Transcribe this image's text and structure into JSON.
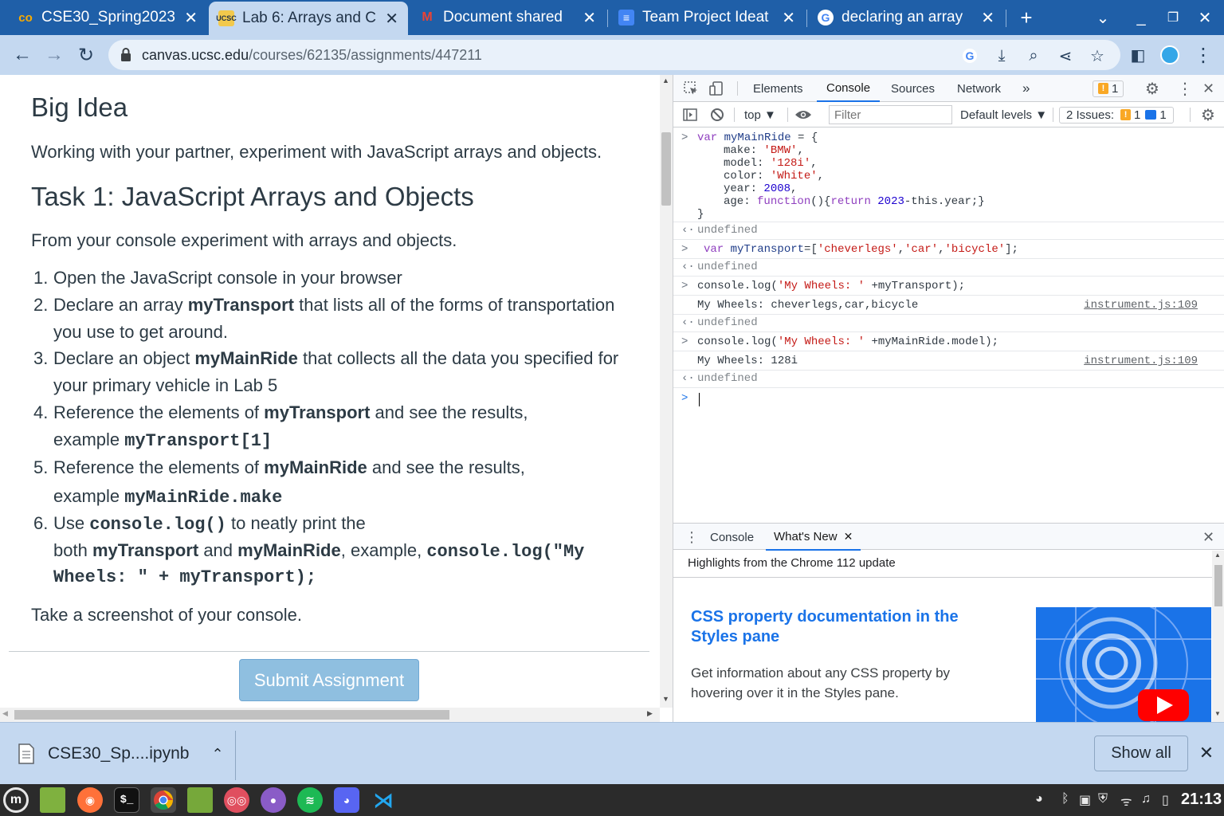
{
  "browser": {
    "tabs": [
      {
        "title": "CSE30_Spring2023",
        "icon": "colab-icon"
      },
      {
        "title": "Lab 6: Arrays and C",
        "icon": "ucsc-icon"
      },
      {
        "title": "Document shared",
        "icon": "gmail-icon"
      },
      {
        "title": "Team Project Ideat",
        "icon": "docs-icon"
      },
      {
        "title": "declaring an array",
        "icon": "google-icon"
      }
    ],
    "url_host": "canvas.ucsc.edu",
    "url_path": "/courses/62135/assignments/447211"
  },
  "page": {
    "heading1": "Big Idea",
    "intro": "Working with your partner, experiment with JavaScript arrays and objects.",
    "heading2": "Task 1: JavaScript Arrays and Objects",
    "lead": "From your console experiment with arrays and objects.",
    "items": {
      "i1": {
        "num": "1.",
        "text": "Open the JavaScript console in your browser"
      },
      "i2": {
        "num": "2.",
        "a": "Declare an array ",
        "b": "myTransport",
        "c": " that lists all of the forms of transportation",
        "d": "you use to get around."
      },
      "i3": {
        "num": "3.",
        "a": "Declare an object ",
        "b": "myMainRide",
        "c": " that collects all the data you specified for",
        "d": "your primary vehicle in Lab 5"
      },
      "i4": {
        "num": "4.",
        "a": "Reference the elements of ",
        "b": "myTransport",
        "c": " and see the results,",
        "d": "example ",
        "code": "myTransport[1]"
      },
      "i5": {
        "num": "5.",
        "a": "Reference the elements of ",
        "b": "myMainRide",
        "c": " and see the results,",
        "d": "example ",
        "code": "myMainRide.make"
      },
      "i6": {
        "num": "6.",
        "a": "Use ",
        "code1": "console.log()",
        "b": " to neatly print the",
        "c": "both ",
        "d": "myTransport",
        "e": " and ",
        "f": "myMainRide",
        "g": ", example, ",
        "code2": "console.log(\"My",
        "code3": "Wheels: \" + myTransport);"
      }
    },
    "outro": "Take a screenshot of your console.",
    "submit_label": "Submit Assignment"
  },
  "devtools": {
    "tabs": [
      "Elements",
      "Console",
      "Sources",
      "Network",
      "»"
    ],
    "issues_count": "1",
    "context": "top ▼",
    "filter_placeholder": "Filter",
    "levels": "Default levels ▼",
    "issues_label": "2 Issues:",
    "issues_warn": "1",
    "issues_info": "1",
    "console": {
      "l1_kw": "var",
      "l1_name": "myMainRide",
      "l1_rest": " = {",
      "l2_key": "make: ",
      "l2_val": "'BMW'",
      "l3_key": "model: ",
      "l3_val": "'128i'",
      "l4_key": "color: ",
      "l4_val": "'White'",
      "l5_key": "year: ",
      "l5_val": "2008",
      "l6_key": "age: ",
      "l6_fn": "function",
      "l6_mid": "(){",
      "l6_ret": "return",
      "l6_num": " 2023",
      "l6_tail": "-this.year;}",
      "l7": "}",
      "undefined": "undefined",
      "l8_kw": "var",
      "l8_name": "myTransport",
      "l8_eq": "=[",
      "l8_v1": "'cheverlegs'",
      "l8_v2": "'car'",
      "l8_v3": "'bicycle'",
      "l8_end": "];",
      "l9_a": "console.log(",
      "l9_str": "'My Wheels: '",
      "l9_b": " +myTransport);",
      "out1": "My Wheels: cheverlegs,car,bicycle",
      "src": "instrument.js:109",
      "l10_a": "console.log(",
      "l10_str": "'My Wheels: '",
      "l10_b": " +myMainRide.model);",
      "out2": "My Wheels: 128i"
    },
    "drawer": {
      "tab_console": "Console",
      "tab_whatsnew": "What's New",
      "subtitle": "Highlights from the Chrome 112 update",
      "card_title": "CSS property documentation in the Styles pane",
      "card_desc": "Get information about any CSS property by hovering over it in the Styles pane."
    }
  },
  "downloads": {
    "file": "CSE30_Sp....ipynb",
    "show_all": "Show all"
  },
  "taskbar": {
    "clock": "21:13"
  },
  "colors": {
    "titlebar": "#1f5fa8",
    "toolbar": "#c4d8f0",
    "link_blue": "#1a73e8",
    "submit": "#8fbfe0"
  }
}
